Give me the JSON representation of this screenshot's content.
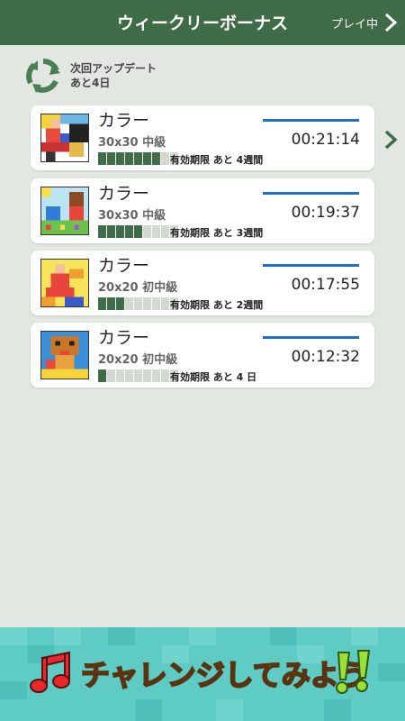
{
  "header": {
    "title": "ウィークリーボーナス",
    "right_label": "プレイ中"
  },
  "update": {
    "line1": "次回アップデート",
    "line2": "あと4日"
  },
  "cards": [
    {
      "title": "カラー",
      "level": "30x30 中級",
      "time": "00:21:14",
      "progress": 7,
      "expiry": "有効期限 あと 4週間"
    },
    {
      "title": "カラー",
      "level": "30x30 中級",
      "time": "00:19:37",
      "progress": 5,
      "expiry": "有効期限 あと 3週間"
    },
    {
      "title": "カラー",
      "level": "20x20 初中級",
      "time": "00:17:55",
      "progress": 3,
      "expiry": "有効期限 あと 2週間"
    },
    {
      "title": "カラー",
      "level": "20x20 初中級",
      "time": "00:12:32",
      "progress": 1,
      "expiry": "有効期限 あと 4 日"
    }
  ],
  "progress_total": 9,
  "banner": {
    "text": "チャレンジしてみよう"
  },
  "colors": {
    "header_bg": "#3f6b46",
    "accent_line": "#1e6fd0",
    "bar_on": "#3e6d48",
    "bar_off": "#d3d8d3",
    "banner_bg": "#5ecbc5"
  },
  "icons": [
    "chevron-right-icon",
    "recycle-icon",
    "music-note-icon",
    "double-exclamation-icon"
  ]
}
